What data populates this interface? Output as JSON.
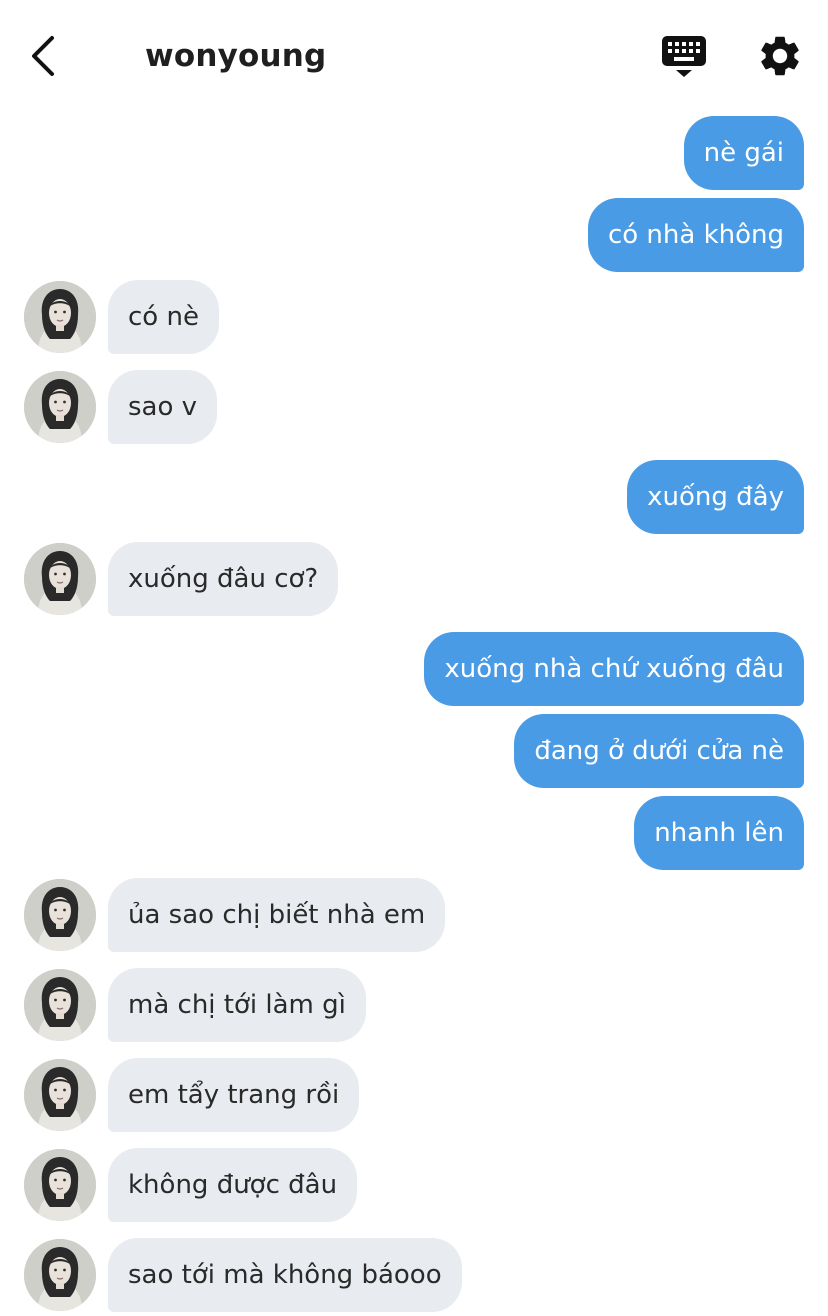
{
  "header": {
    "title": "wonyoung",
    "back_icon": "chevron-left-icon",
    "keyboard_icon": "keyboard-hide-icon",
    "settings_icon": "gear-icon"
  },
  "colors": {
    "outgoing_bubble": "#4a9be6",
    "incoming_bubble": "#e8ebef",
    "outgoing_text": "#ffffff",
    "incoming_text": "#2a2a2a"
  },
  "messages": [
    {
      "side": "out",
      "text": "nè gái"
    },
    {
      "side": "out",
      "text": "có nhà không"
    },
    {
      "side": "in",
      "text": "có nè"
    },
    {
      "side": "in",
      "text": "sao v"
    },
    {
      "side": "out",
      "text": "xuống đây"
    },
    {
      "side": "in",
      "text": "xuống đâu cơ?"
    },
    {
      "side": "out",
      "text": "xuống nhà chứ xuống đâu"
    },
    {
      "side": "out",
      "text": "đang ở dưới cửa nè"
    },
    {
      "side": "out",
      "text": "nhanh lên"
    },
    {
      "side": "in",
      "text": "ủa sao chị biết nhà em"
    },
    {
      "side": "in",
      "text": "mà chị tới làm gì"
    },
    {
      "side": "in",
      "text": "em tẩy trang rồi"
    },
    {
      "side": "in",
      "text": "không được đâu"
    },
    {
      "side": "in",
      "text": "sao tới mà không báooo"
    }
  ]
}
